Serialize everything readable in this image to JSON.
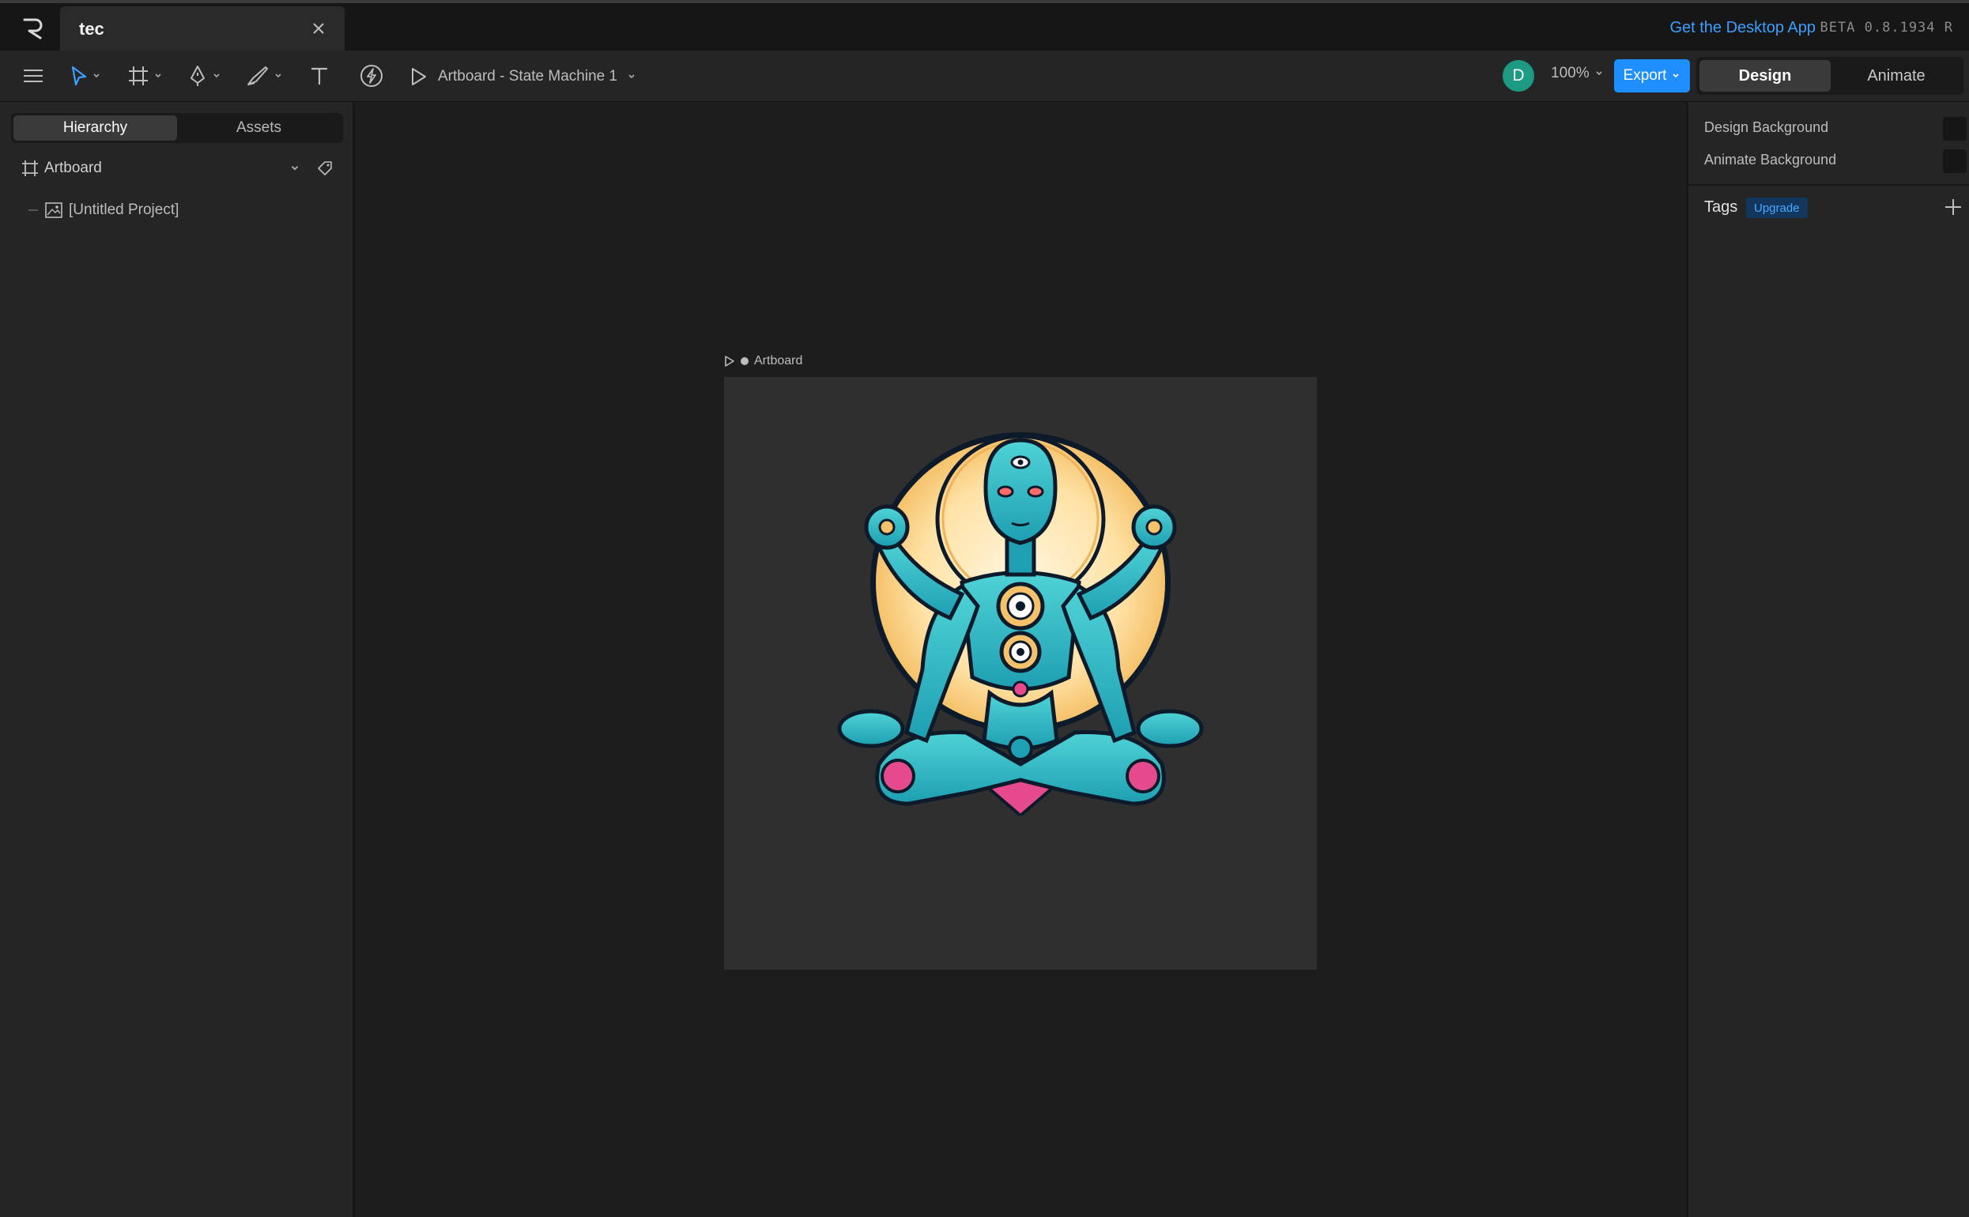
{
  "tab": {
    "title": "tec"
  },
  "header": {
    "desktop_link": "Get the Desktop App",
    "version": "BETA 0.8.1934 R"
  },
  "toolbar": {
    "artboard_selector": "Artboard - State Machine 1",
    "avatar_initial": "D",
    "zoom": "100%",
    "export_label": "Export",
    "mode_design": "Design",
    "mode_animate": "Animate"
  },
  "left_panel": {
    "tab_hierarchy": "Hierarchy",
    "tab_assets": "Assets",
    "items": [
      {
        "label": "Artboard"
      },
      {
        "label": "[Untitled Project]"
      }
    ]
  },
  "stage": {
    "artboard_label": "Artboard"
  },
  "right_panel": {
    "design_background": "Design Background",
    "animate_background": "Animate Background",
    "tags_label": "Tags",
    "upgrade_label": "Upgrade"
  }
}
